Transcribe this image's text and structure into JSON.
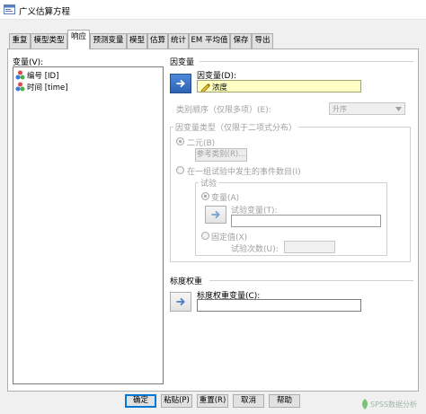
{
  "window": {
    "title": "广义估算方程",
    "icon": "spss-dialog-icon"
  },
  "tabs": [
    {
      "label": "重复"
    },
    {
      "label": "模型类型"
    },
    {
      "label": "响应",
      "active": true
    },
    {
      "label": "预测变量"
    },
    {
      "label": "模型"
    },
    {
      "label": "估算"
    },
    {
      "label": "统计"
    },
    {
      "label": "EM 平均值"
    },
    {
      "label": "保存"
    },
    {
      "label": "导出"
    }
  ],
  "variables": {
    "label": "变量(V):",
    "items": [
      {
        "label": "编号 [ID]",
        "icon": "nominal-variable-icon"
      },
      {
        "label": "时间 [time]",
        "icon": "nominal-variable-icon"
      }
    ]
  },
  "dependent": {
    "section_label": "因变量",
    "field_label": "因变量(D):",
    "value": "浓度",
    "value_icon": "scale-variable-icon",
    "category_order_label": "类别顺序（仅限多项）(E):",
    "category_order_value": "升序",
    "type_group_label": "因变量类型（仅限于二项式分布）",
    "binary_label": "二元(B)",
    "reference_button": "参考类别(R)...",
    "events_label": "在一组试验中发生的事件数目(I)",
    "trials_group_label": "试验",
    "variable_option": "变量(A)",
    "trial_variable_label": "试验变量(T):",
    "fixed_option": "固定值(X)",
    "trial_count_label": "试验次数(U):"
  },
  "scale_weight": {
    "section_label": "标度权重",
    "field_label": "标度权重变量(C):",
    "value": ""
  },
  "buttons": {
    "ok": "确定",
    "paste": "粘贴(P)",
    "reset": "重置(R)",
    "cancel": "取消",
    "help": "帮助"
  },
  "watermark": {
    "text": "SPSS数据分析",
    "icon": "leaf-logo-icon"
  },
  "colors": {
    "selected_tab": "#ffffff",
    "dependent_field": "#ffffc4",
    "arrow_active": "#2e63b5"
  }
}
